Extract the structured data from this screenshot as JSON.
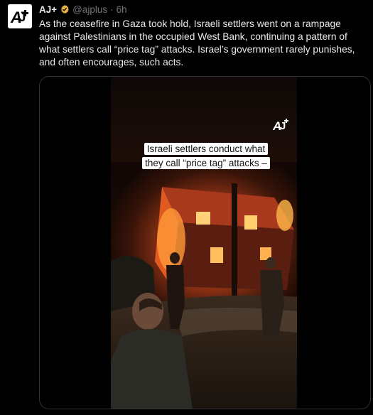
{
  "tweet": {
    "author_name": "AJ+",
    "handle": "@ajplus",
    "separator": "·",
    "time": "6h",
    "text": "As the ceasefire in Gaza took hold, Israeli settlers went on a rampage against Palestinians in the occupied West Bank, continuing a pattern of what settlers call “price tag” attacks. Israel’s government rarely punishes, and often encourages, such acts."
  },
  "video": {
    "caption": "Israeli settlers conduct what they call “price tag” attacks –"
  },
  "icons": {
    "avatar": "aj-plus-logo",
    "verified": "verified-badge",
    "watermark": "aj-plus-logo"
  },
  "colors": {
    "verified": "#e8b04a",
    "text": "#e7e9ea",
    "muted": "#71767b",
    "border": "#2f3336"
  }
}
